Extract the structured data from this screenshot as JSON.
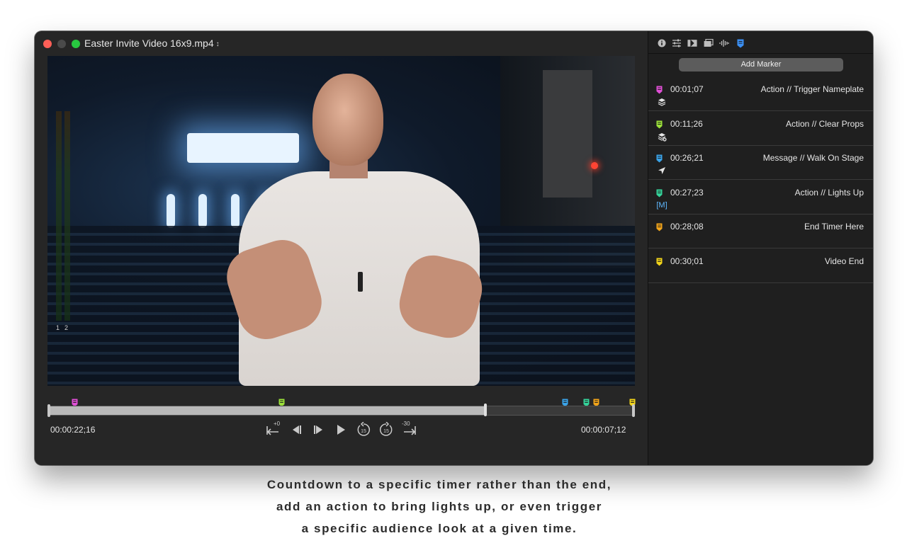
{
  "window": {
    "title": "Easter Invite Video 16x9.mp4",
    "title_chevron": "⌃⌄"
  },
  "player": {
    "elapsed_time": "00:00:22;16",
    "remaining_time": "00:00:07;12",
    "progress": 0.745,
    "audio_meter": {
      "channel_1": "1",
      "channel_2": "2"
    },
    "controls": {
      "go_to_start_offset": "+0",
      "skip_back_label": "15",
      "skip_forward_label": "15",
      "go_to_end_offset": "-30"
    }
  },
  "timeline_markers": [
    {
      "position": 0.045,
      "color": "#e04fd6"
    },
    {
      "position": 0.397,
      "color": "#9be03a"
    },
    {
      "position": 0.881,
      "color": "#3aa3e8"
    },
    {
      "position": 0.917,
      "color": "#34d39a"
    },
    {
      "position": 0.933,
      "color": "#f2a41a"
    },
    {
      "position": 0.995,
      "color": "#f2d41a"
    }
  ],
  "inspector": {
    "toolbar_icons": [
      "info-icon",
      "sliders-icon",
      "transition-icon",
      "layers-icon",
      "waveform-icon",
      "marker-icon"
    ],
    "add_marker_label": "Add Marker",
    "markers": [
      {
        "time": "00:01;07",
        "name": "Action // Trigger Nameplate",
        "color": "#e04fd6",
        "icon": "layers-icon"
      },
      {
        "time": "00:11;26",
        "name": "Action // Clear Props",
        "color": "#9be03a",
        "icon": "clear-layers-icon"
      },
      {
        "time": "00:26;21",
        "name": "Message // Walk On Stage",
        "color": "#3aa3e8",
        "icon": "send-message-icon"
      },
      {
        "time": "00:27;23",
        "name": "Action // Lights Up",
        "color": "#34d39a",
        "icon": "macro-icon",
        "icon_text": "[M]"
      },
      {
        "time": "00:28;08",
        "name": "End Timer Here",
        "color": "#f2a41a",
        "icon": ""
      },
      {
        "time": "00:30;01",
        "name": "Video End",
        "color": "#f2d41a",
        "icon": ""
      }
    ]
  },
  "caption": {
    "line1": "Countdown to a specific timer rather than the end,",
    "line2": "add an action to bring lights up, or even trigger",
    "line3": "a  specific audience look at a given time."
  }
}
